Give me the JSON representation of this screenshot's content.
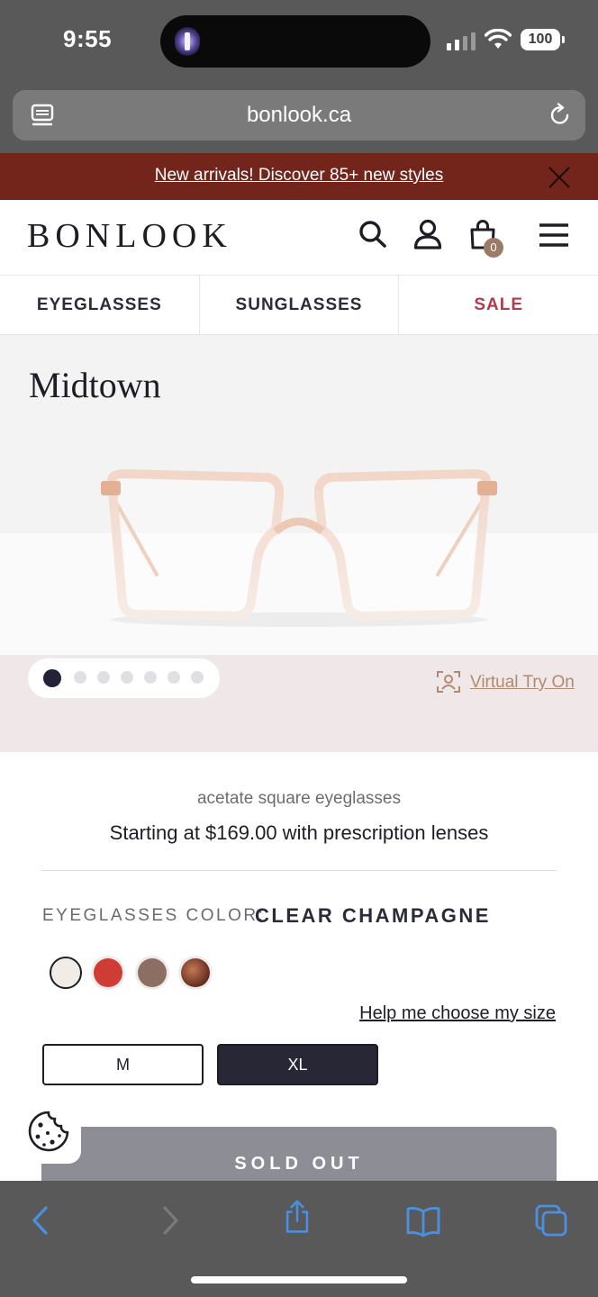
{
  "status_bar": {
    "time": "9:55",
    "battery": "100"
  },
  "browser": {
    "url": "bonlook.ca"
  },
  "promo": {
    "text": "New arrivals! Discover 85+ new styles"
  },
  "header": {
    "logo": "BONLOOK",
    "cart_count": "0"
  },
  "nav": {
    "items": [
      "EYEGLASSES",
      "SUNGLASSES",
      "SALE"
    ]
  },
  "product": {
    "title": "Midtown",
    "subtitle": "acetate square eyeglasses",
    "price_line": "Starting at $169.00 with prescription lenses",
    "color_label": "EYEGLASSES COLOR:",
    "color_value": "CLEAR CHAMPAGNE",
    "swatches": [
      {
        "name": "clear-champagne",
        "color": "#f1ece6",
        "selected": true
      },
      {
        "name": "red",
        "color": "#cf3b35",
        "selected": false
      },
      {
        "name": "taupe",
        "color": "#8d6e63",
        "selected": false
      },
      {
        "name": "tortoise",
        "color": "#7a3d2a",
        "selected": false
      }
    ],
    "size_help": "Help me choose my size",
    "sizes": [
      "M",
      "XL"
    ],
    "selected_size": "XL",
    "cta": "SOLD OUT"
  },
  "carousel": {
    "total": 7,
    "active": 1
  },
  "virtual_try_on": "Virtual Try On",
  "colors": {
    "promo_bg": "#73251c",
    "accent": "#b08a6f",
    "sale": "#b13a4c",
    "dark": "#272735"
  }
}
